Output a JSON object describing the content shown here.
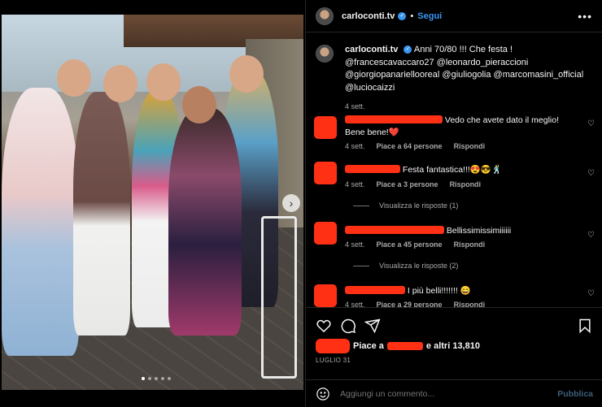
{
  "post": {
    "username": "carloconti.tv",
    "follow_label": "Segui",
    "more_label": "•••",
    "caption_text": "Anni 70/80 !!! Che festa ! @francescavaccaro27 @leonardo_pieraccioni @giorgiopanariellooreal @giuliogolia @marcomasini_official @luciocaizzi",
    "caption_time": "4 sett.",
    "carousel": {
      "total_dots": 5,
      "active_index": 0
    }
  },
  "comments": [
    {
      "text": "Vedo che avete dato il meglio! Bene bene!❤️",
      "time": "4 sett.",
      "likes": "Piace a 64 persone",
      "reply": "Rispondi",
      "view_replies": null
    },
    {
      "text": "Festa fantastica!!!😍😎🕺",
      "time": "4 sett.",
      "likes": "Piace a 3 persone",
      "reply": "Rispondi",
      "view_replies": "Visualizza le risposte (1)"
    },
    {
      "text": "Bellissimissimiiiiii",
      "time": "4 sett.",
      "likes": "Piace a 45 persone",
      "reply": "Rispondi",
      "view_replies": "Visualizza le risposte (2)"
    },
    {
      "text": "I più belli!!!!!!! 😄",
      "time": "4 sett.",
      "likes": "Piace a 29 persone",
      "reply": "Rispondi",
      "view_replies": null
    }
  ],
  "actions": {
    "likes_prefix": "Piace a",
    "likes_suffix": "e altri 13,810",
    "date": "LUGLIO 31"
  },
  "composer": {
    "placeholder": "Aggiungi un commento...",
    "publish_label": "Pubblica"
  },
  "colors": {
    "accent": "#3897f0",
    "redaction": "#ff3014",
    "background": "#000000"
  }
}
